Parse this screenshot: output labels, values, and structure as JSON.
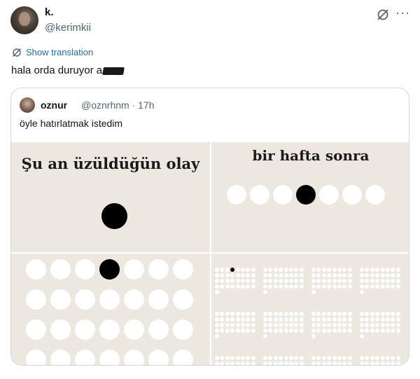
{
  "tweet": {
    "name": "k.",
    "handle": "@kerimkii",
    "show_translation": "Show translation",
    "text": "hala orda duruyor a"
  },
  "quote": {
    "name": "oznur",
    "meta": "@oznrhnm · 17h",
    "text": "öyle hatırlatmak istedim",
    "panels": {
      "top_left_title": "Şu an üzüldüğün olay",
      "top_right_title": "bir hafta sonra"
    }
  },
  "icons": {
    "grok": "grok-icon",
    "more": "more-icon",
    "translate": "translate-icon"
  },
  "colors": {
    "link": "#1d6fa5",
    "panel_bg": "#ece8df",
    "muted": "#536471"
  }
}
